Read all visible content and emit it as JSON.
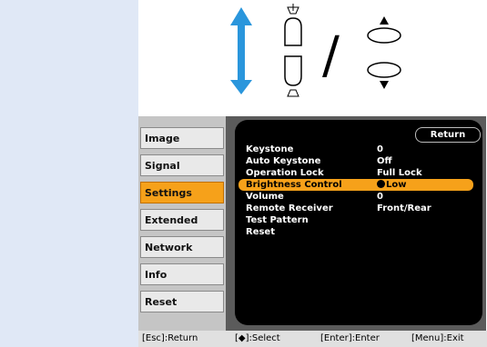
{
  "illustration": {
    "arrow_icon": "double-vertical-arrow-icon",
    "keystone_up_icon": "keystone-up-icon",
    "keystone_down_icon": "keystone-down-icon",
    "separator": "/",
    "up_triangle_icon": "up-triangle-icon",
    "down_triangle_icon": "down-triangle-icon",
    "arrow_color": "#2a96dc"
  },
  "menu": {
    "sidebar": [
      {
        "label": "Image",
        "active": false
      },
      {
        "label": "Signal",
        "active": false
      },
      {
        "label": "Settings",
        "active": true
      },
      {
        "label": "Extended",
        "active": false
      },
      {
        "label": "Network",
        "active": false
      },
      {
        "label": "Info",
        "active": false
      },
      {
        "label": "Reset",
        "active": false
      }
    ],
    "return_label": "Return",
    "rows": [
      {
        "label": "Keystone",
        "value": "0"
      },
      {
        "label": "Auto Keystone",
        "value": "Off"
      },
      {
        "label": "Operation Lock",
        "value": "Full Lock"
      },
      {
        "label": "Brightness Control",
        "value": "Low"
      },
      {
        "label": "Volume",
        "value": "0"
      },
      {
        "label": "Remote Receiver",
        "value": "Front/Rear"
      },
      {
        "label": "Test Pattern",
        "value": ""
      },
      {
        "label": "Reset",
        "value": ""
      }
    ],
    "highlight_color": "#f6a11a"
  },
  "footer": {
    "esc": "[Esc]:Return",
    "select": "[◆]:Select",
    "enter": "[Enter]:Enter",
    "menu": "[Menu]:Exit"
  }
}
